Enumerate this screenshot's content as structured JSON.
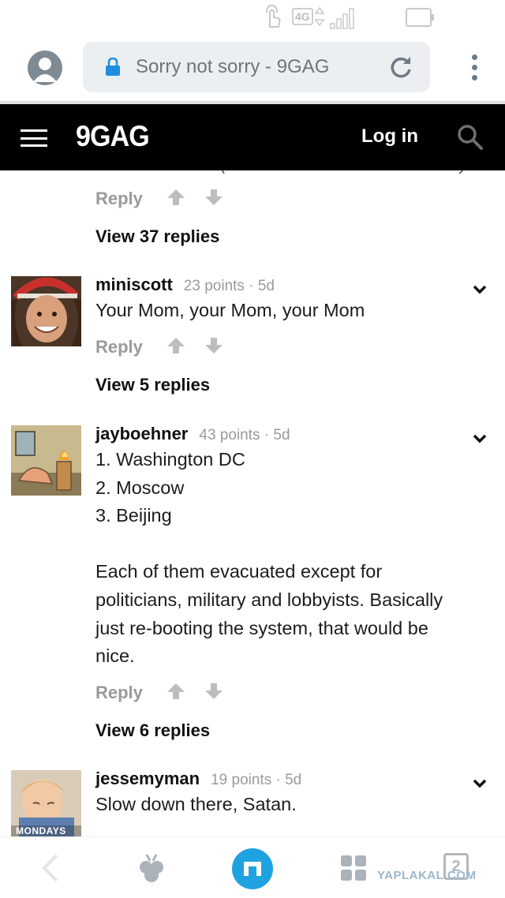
{
  "status_bar": {
    "network": "4G",
    "icons": [
      "touch-icon",
      "data-arrows-icon",
      "signal-icon",
      "battery-icon"
    ]
  },
  "browser": {
    "url_title": "Sorry not sorry - 9GAG",
    "icons": [
      "profile-icon",
      "lock-icon",
      "reload-icon",
      "more-vert-icon"
    ]
  },
  "site_header": {
    "logo": "9GAG",
    "login_label": "Log in",
    "colors": {
      "background": "#000000",
      "text": "#ffffff"
    }
  },
  "feed": {
    "top_actions": {
      "reply_label": "Reply"
    },
    "top_view_replies": "View 37 replies",
    "comments": [
      {
        "username": "miniscott",
        "points": "23 points",
        "age": "5d",
        "text_lines": [
          "Your Mom, your Mom, your Mom"
        ],
        "reply_label": "Reply",
        "view_replies": "View 5 replies"
      },
      {
        "username": "jayboehner",
        "points": "43 points",
        "age": "5d",
        "text_lines": [
          "1. Washington DC",
          "2. Moscow",
          "3. Beijing",
          "",
          "Each of them evacuated except for",
          "politicians, military and lobbyists. Basically",
          "just re-booting the system, that would be",
          "nice."
        ],
        "reply_label": "Reply",
        "view_replies": "View 6 replies"
      },
      {
        "username": "jessemyman",
        "points": "19 points",
        "age": "5d",
        "text_lines": [
          "Slow down there, Satan."
        ],
        "avatar_caption": "MONDAYS"
      }
    ],
    "meta_separator": "·",
    "colors": {
      "muted": "#9a9a9a",
      "text": "#1c1c1c"
    }
  },
  "bottom_nav": {
    "tab_count": "2",
    "watermark": "YAPLAKAL.COM",
    "accent": "#1fa2e0",
    "icons": [
      "back-icon",
      "bug-icon",
      "home-icon",
      "apps-grid-icon",
      "tabs-icon"
    ]
  }
}
